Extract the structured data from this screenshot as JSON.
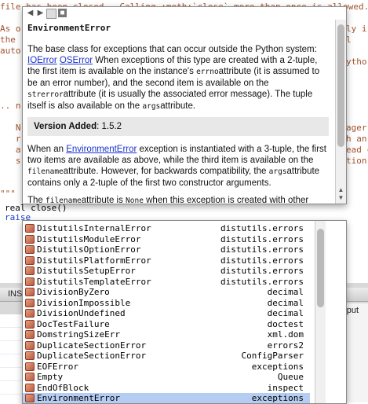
{
  "editor": {
    "top_line": "file has been closed.  Calling :meth:`close` more than once is allowed.",
    "left_fragments": [
      "As o",
      "the",
      "auto",
      "",
      "",
      "",
      "",
      ".. n",
      "",
      "   N",
      "   r",
      "   a",
      "   s",
      "",
      "",
      "\"\"\""
    ],
    "right_fragments": [
      "ly i",
      "l",
      "",
      "ytho",
      "",
      "",
      "",
      "",
      "",
      "ager",
      "h an",
      "ead c",
      "tion",
      "",
      ""
    ],
    "close_line": "real close()",
    "raise_keyword": "raise",
    "panel_tab": "INS",
    "output_label": "Output"
  },
  "tooltip": {
    "title": "EnvironmentError",
    "p1_a": "The base class for exceptions that can occur outside the Python system:",
    "link1": "IOError",
    "link2": "OSError",
    "p1_b": " When exceptions of this type are created with a 2-tuple, the first item is available on the instance's ",
    "mono_errno": "errno",
    "p1_c": "attribute (it is assumed to be an error number), and the second item is available on the ",
    "mono_strerror": "strerror",
    "p1_d": "attribute (it is usually the associated error message). The tuple itself is also available on the ",
    "mono_args": "args",
    "p1_e": "attribute.",
    "version_label": "Version Added",
    "version_value": ": 1.5.2",
    "p2_a": "When an ",
    "link3": "EnvironmentError",
    "p2_b": " exception is instantiated with a 3-tuple, the first two items are available as above, while the third item is available on the ",
    "mono_filename": "filename",
    "p2_c": "attribute. However, for backwards compatibility, the ",
    "mono_args2": "args",
    "p2_d": "attribute contains only a 2-tuple of the first two constructor arguments.",
    "p3_a": "The ",
    "mono_filename2": "filename",
    "p3_b": "attribute is ",
    "mono_none": "None",
    "p3_c": " when this exception is created with other"
  },
  "completion": {
    "items": [
      {
        "name": "DistutilsInternalError",
        "module": "distutils.errors"
      },
      {
        "name": "DistutilsModuleError",
        "module": "distutils.errors"
      },
      {
        "name": "DistutilsOptionError",
        "module": "distutils.errors"
      },
      {
        "name": "DistutilsPlatformError",
        "module": "distutils.errors"
      },
      {
        "name": "DistutilsSetupError",
        "module": "distutils.errors"
      },
      {
        "name": "DistutilsTemplateError",
        "module": "distutils.errors"
      },
      {
        "name": "DivisionByZero",
        "module": "decimal"
      },
      {
        "name": "DivisionImpossible",
        "module": "decimal"
      },
      {
        "name": "DivisionUndefined",
        "module": "decimal"
      },
      {
        "name": "DocTestFailure",
        "module": "doctest"
      },
      {
        "name": "DomstringSizeErr",
        "module": "xml.dom"
      },
      {
        "name": "DuplicateSectionError",
        "module": "errors2"
      },
      {
        "name": "DuplicateSectionError",
        "module": "ConfigParser"
      },
      {
        "name": "EOFError",
        "module": "exceptions"
      },
      {
        "name": "Empty",
        "module": "Queue"
      },
      {
        "name": "EndOfBlock",
        "module": "inspect"
      },
      {
        "name": "EnvironmentError",
        "module": "exceptions",
        "selected": true
      }
    ]
  },
  "colors": {
    "code_string": "#a0522d",
    "keyword": "#1a3acb",
    "link": "#1a33cc",
    "selection": "#b5cdf2"
  }
}
